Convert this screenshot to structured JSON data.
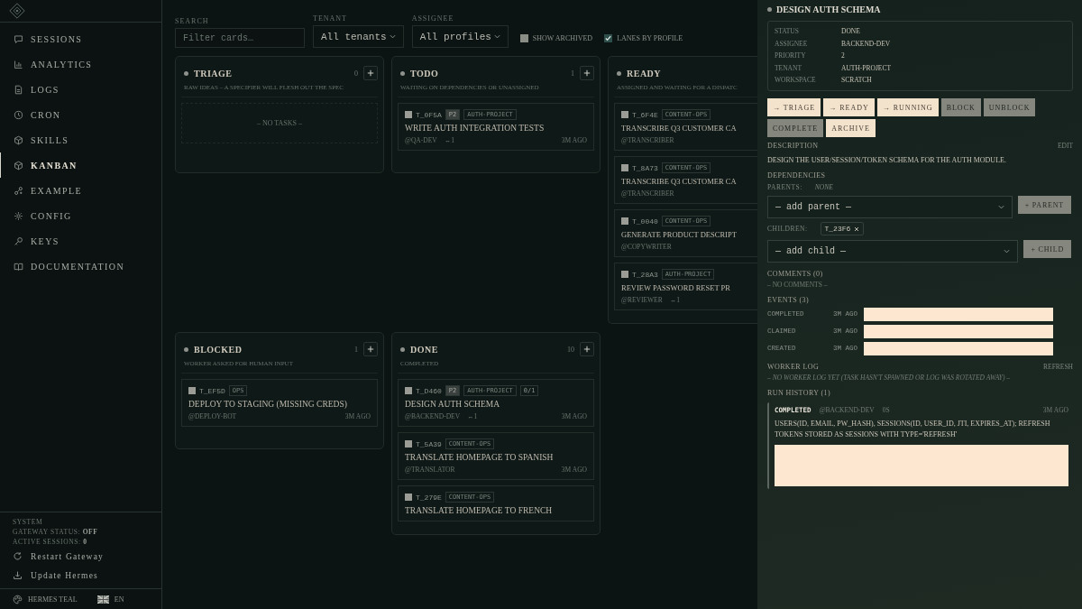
{
  "sidebar": {
    "items": [
      {
        "label": "SESSIONS",
        "selected": false
      },
      {
        "label": "ANALYTICS",
        "selected": false
      },
      {
        "label": "LOGS",
        "selected": false
      },
      {
        "label": "CRON",
        "selected": false
      },
      {
        "label": "SKILLS",
        "selected": false
      },
      {
        "label": "KANBAN",
        "selected": true
      },
      {
        "label": "EXAMPLE",
        "selected": false
      },
      {
        "label": "CONFIG",
        "selected": false
      },
      {
        "label": "KEYS",
        "selected": false
      },
      {
        "label": "DOCUMENTATION",
        "selected": false
      }
    ],
    "system": {
      "title": "SYSTEM",
      "gateway_label": "GATEWAY STATUS:",
      "gateway_value": "OFF",
      "sessions_label": "ACTIVE SESSIONS:",
      "sessions_value": "0"
    },
    "actions": [
      "Restart Gateway",
      "Update Hermes"
    ],
    "theme": "HERMES TEAL",
    "language": "EN"
  },
  "filters": {
    "search_label": "SEARCH",
    "search_placeholder": "Filter cards…",
    "tenant_label": "TENANT",
    "tenant_value": "All tenants",
    "assignee_label": "ASSIGNEE",
    "assignee_value": "All profiles",
    "toggles": [
      {
        "label": "SHOW ARCHIVED",
        "checked": false
      },
      {
        "label": "LANES BY PROFILE",
        "checked": true
      }
    ]
  },
  "lanes": [
    {
      "title": "TRIAGE",
      "count": "0",
      "description": "RAW IDEAS – A SPECIFIER WILL FLESH OUT THE SPEC",
      "empty": "– NO TASKS –"
    },
    {
      "title": "TODO",
      "count": "1",
      "description": "WAITING ON DEPENDENCIES OR UNASSIGNED",
      "cards": [
        {
          "id": "T_0F5A",
          "checked": false,
          "tags": [
            {
              "kind": "priority",
              "text": "P2"
            },
            {
              "kind": "tenant",
              "text": "AUTH-PROJECT"
            }
          ],
          "title": "WRITE AUTH INTEGRATION TESTS",
          "assignee": "@QA-DEV",
          "links": "↔1",
          "age": "3M AGO"
        }
      ]
    },
    {
      "title": "READY",
      "description": "ASSIGNED AND WAITING FOR A DISPATC",
      "cards": [
        {
          "id": "T_6F4E",
          "checked": false,
          "tags": [
            {
              "kind": "tenant",
              "text": "CONTENT-OPS"
            }
          ],
          "title": "TRANSCRIBE Q3 CUSTOMER CA",
          "assignee": "@TRANSCRIBER"
        },
        {
          "id": "T_8A73",
          "checked": false,
          "tags": [
            {
              "kind": "tenant",
              "text": "CONTENT-OPS"
            }
          ],
          "title": "TRANSCRIBE Q3 CUSTOMER CA",
          "assignee": "@TRANSCRIBER"
        },
        {
          "id": "T_0040",
          "checked": false,
          "tags": [
            {
              "kind": "tenant",
              "text": "CONTENT-OPS"
            }
          ],
          "title": "GENERATE PRODUCT DESCRIPT",
          "assignee": "@COPYWRITER"
        },
        {
          "id": "T_28A3",
          "checked": false,
          "tags": [
            {
              "kind": "tenant",
              "text": "AUTH-PROJECT"
            }
          ],
          "title": "REVIEW PASSWORD RESET PR",
          "assignee": "@REVIEWER",
          "links": "↔1"
        }
      ]
    },
    {
      "title": "BLOCKED",
      "count": "1",
      "description": "WORKER ASKED FOR HUMAN INPUT",
      "cards": [
        {
          "id": "T_EF5D",
          "checked": false,
          "tags": [
            {
              "kind": "tenant",
              "text": "OPS"
            }
          ],
          "title": "DEPLOY TO STAGING (MISSING CREDS)",
          "assignee": "@DEPLOY-BOT",
          "age": "3M AGO"
        }
      ]
    },
    {
      "title": "DONE",
      "count": "10",
      "description": "COMPLETED",
      "cards": [
        {
          "id": "T_D460",
          "checked": false,
          "tags": [
            {
              "kind": "priority",
              "text": "P2"
            },
            {
              "kind": "tenant",
              "text": "AUTH-PROJECT"
            },
            {
              "kind": "progress",
              "text": "0/1"
            }
          ],
          "title": "DESIGN AUTH SCHEMA",
          "assignee": "@BACKEND-DEV",
          "links": "↔1",
          "age": "3M AGO"
        },
        {
          "id": "T_5A39",
          "checked": false,
          "tags": [
            {
              "kind": "tenant",
              "text": "CONTENT-OPS"
            }
          ],
          "title": "TRANSLATE HOMEPAGE TO SPANISH",
          "assignee": "@TRANSLATOR",
          "age": "3M AGO"
        },
        {
          "id": "T_279E",
          "checked": false,
          "tags": [
            {
              "kind": "tenant",
              "text": "CONTENT-OPS"
            }
          ],
          "title": "TRANSLATE HOMEPAGE TO FRENCH"
        }
      ]
    }
  ],
  "drawer": {
    "title": "DESIGN AUTH SCHEMA",
    "fields": [
      {
        "label": "STATUS",
        "value": "DONE"
      },
      {
        "label": "ASSIGNEE",
        "value": "BACKEND-DEV"
      },
      {
        "label": "PRIORITY",
        "value": "2"
      },
      {
        "label": "TENANT",
        "value": "AUTH-PROJECT"
      },
      {
        "label": "WORKSPACE",
        "value": "SCRATCH"
      }
    ],
    "buttons": [
      {
        "label": "→ TRIAGE",
        "disabled": false
      },
      {
        "label": "→ READY",
        "disabled": false
      },
      {
        "label": "→ RUNNING",
        "disabled": false
      },
      {
        "label": "BLOCK",
        "disabled": true
      },
      {
        "label": "UNBLOCK",
        "disabled": true
      },
      {
        "label": "COMPLETE",
        "disabled": true
      },
      {
        "label": "ARCHIVE",
        "disabled": false
      }
    ],
    "description_heading": "DESCRIPTION",
    "edit": "EDIT",
    "description": "DESIGN THE USER/SESSION/TOKEN SCHEMA FOR THE AUTH MODULE.",
    "dependencies_heading": "DEPENDENCIES",
    "parents_label": "PARENTS:",
    "parents_value": "NONE",
    "parent_select": "— add parent —",
    "parent_button": "+ PARENT",
    "children_label": "CHILDREN:",
    "children": [
      "T_23F6"
    ],
    "child_select": "— add child —",
    "child_button": "+ CHILD",
    "comments_heading": "COMMENTS (0)",
    "comments_empty": "– NO COMMENTS –",
    "events_heading": "EVENTS (3)",
    "events": [
      {
        "name": "COMPLETED",
        "time": "3M AGO"
      },
      {
        "name": "CLAIMED",
        "time": "3M AGO"
      },
      {
        "name": "CREATED",
        "time": "3M AGO"
      }
    ],
    "worker_log_heading": "WORKER LOG",
    "refresh": "REFRESH",
    "worker_log_empty": "– NO WORKER LOG YET (TASK HASN'T SPAWNED OR LOG WAS ROTATED AWAY) –",
    "runs_heading": "RUN HISTORY (1)",
    "runs": [
      {
        "status": "COMPLETED",
        "assignee": "@BACKEND-DEV",
        "duration": "0S",
        "age": "3M AGO",
        "summary": "USERS(ID, EMAIL, PW_HASH), SESSIONS(ID, USER_ID, JTI, EXPIRES_AT); REFRESH TOKENS STORED AS SESSIONS WITH TYPE='REFRESH'"
      }
    ]
  }
}
